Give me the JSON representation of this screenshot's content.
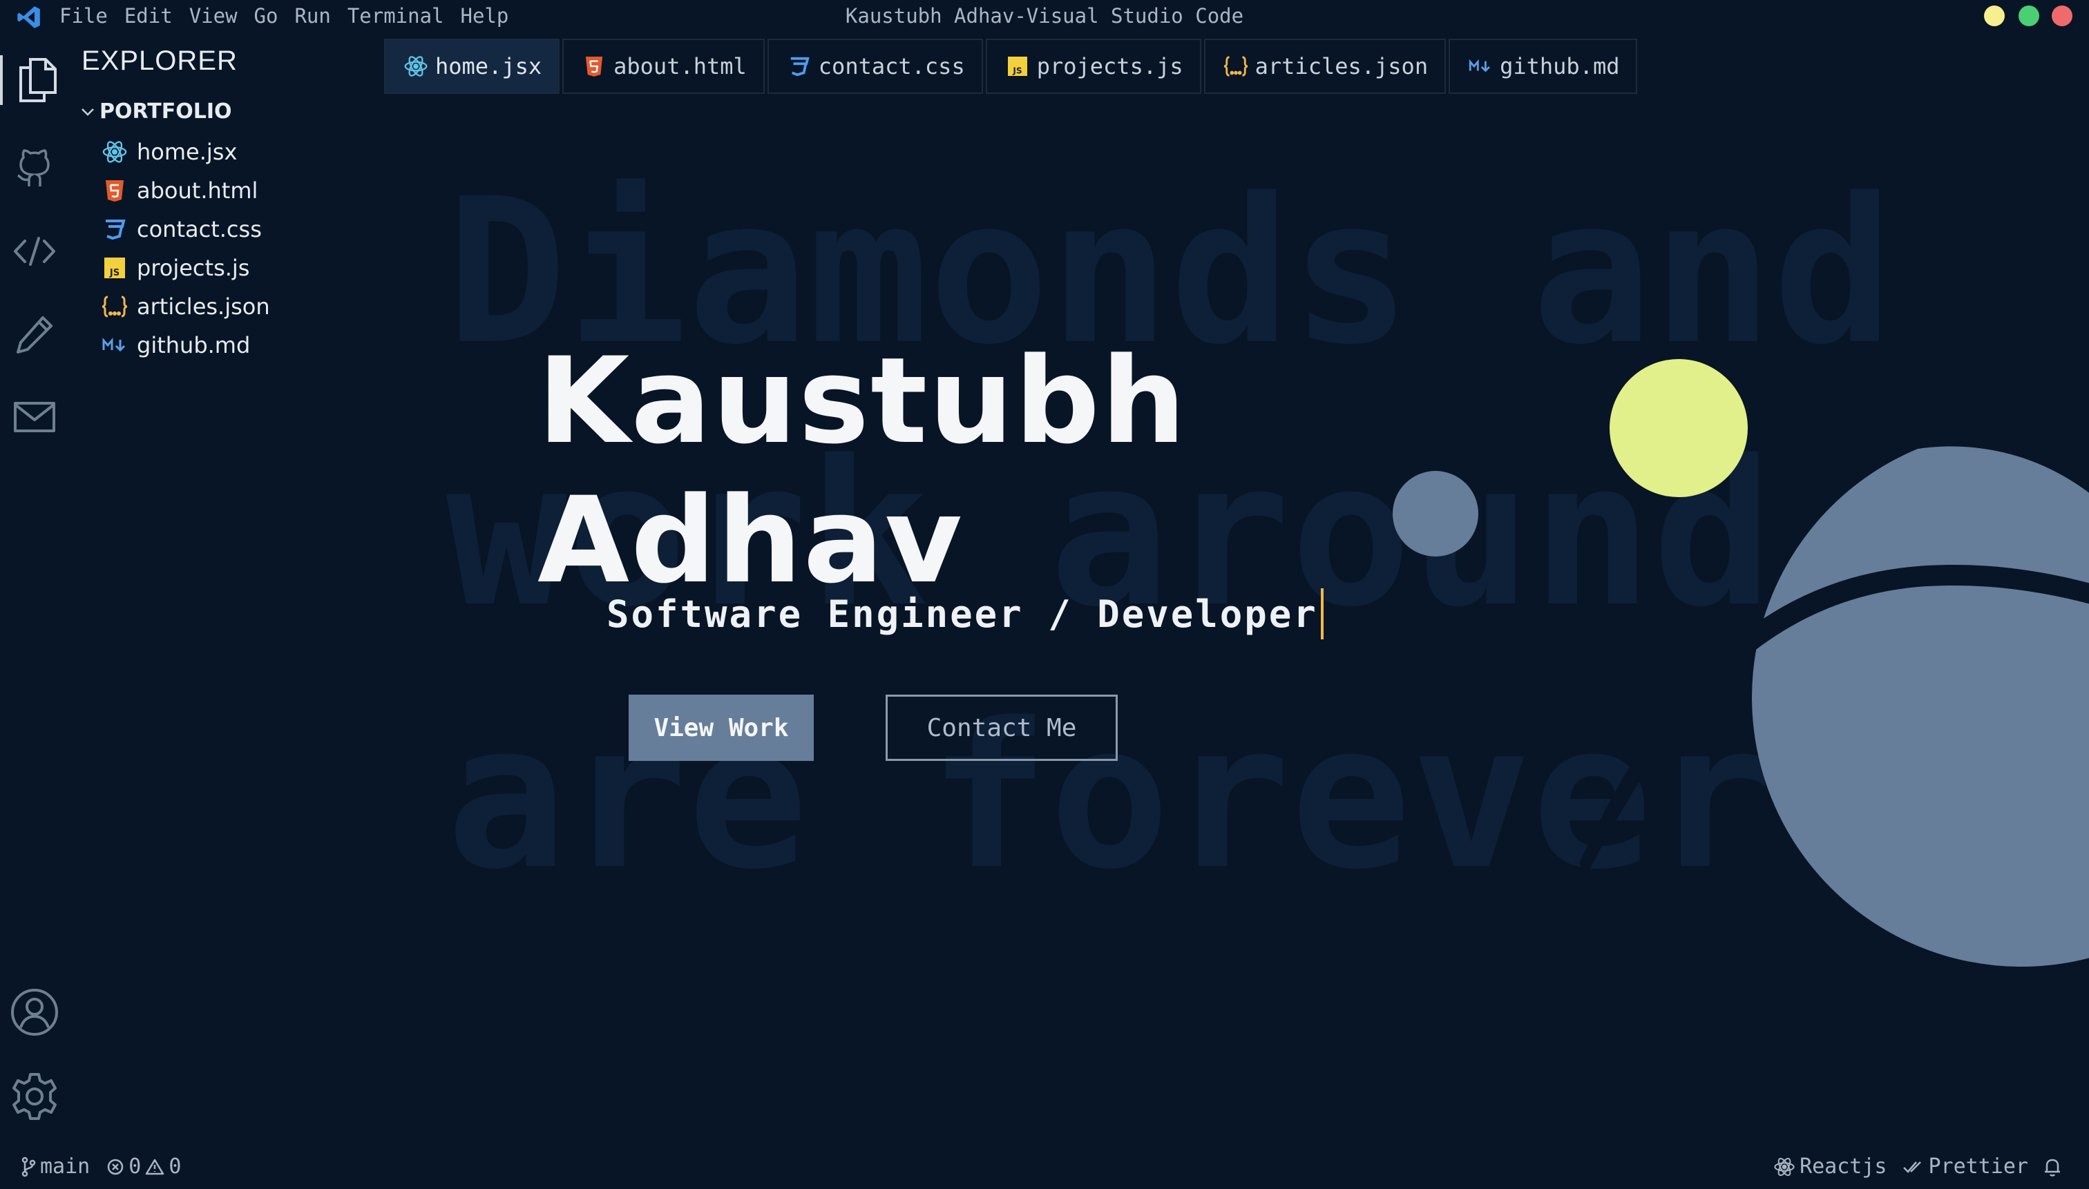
{
  "window": {
    "title": "Kaustubh Adhav-Visual Studio Code",
    "controls": [
      {
        "name": "minimize",
        "color": "#f7ee8f"
      },
      {
        "name": "maximize",
        "color": "#4bcf73"
      },
      {
        "name": "close",
        "color": "#ef6b6b"
      }
    ]
  },
  "menu": [
    "File",
    "Edit",
    "View",
    "Go",
    "Run",
    "Terminal",
    "Help"
  ],
  "activity_bar": {
    "top": [
      "files-icon",
      "github-icon",
      "code-icon",
      "pencil-icon",
      "mail-icon"
    ],
    "bottom": [
      "account-icon",
      "settings-gear-icon"
    ]
  },
  "sidebar": {
    "title": "EXPLORER",
    "folder": "PORTFOLIO",
    "files": [
      {
        "name": "home.jsx",
        "icon": "react-icon"
      },
      {
        "name": "about.html",
        "icon": "html5-icon"
      },
      {
        "name": "contact.css",
        "icon": "css3-icon"
      },
      {
        "name": "projects.js",
        "icon": "javascript-icon"
      },
      {
        "name": "articles.json",
        "icon": "json-icon"
      },
      {
        "name": "github.md",
        "icon": "markdown-icon"
      }
    ]
  },
  "tabs": [
    {
      "label": "home.jsx",
      "icon": "react-icon",
      "active": true
    },
    {
      "label": "about.html",
      "icon": "html5-icon"
    },
    {
      "label": "contact.css",
      "icon": "css3-icon"
    },
    {
      "label": "projects.js",
      "icon": "javascript-icon"
    },
    {
      "label": "articles.json",
      "icon": "json-icon"
    },
    {
      "label": "github.md",
      "icon": "markdown-icon"
    }
  ],
  "hero": {
    "background_lines": [
      "Diamonds and",
      "work around",
      "are forever"
    ],
    "name_line1": "Kaustubh",
    "name_line2": "Adhav",
    "role": "Software Engineer / Developer",
    "primary_button": "View Work",
    "secondary_button": "Contact Me"
  },
  "statusbar": {
    "branch": "main",
    "errors": "0",
    "warnings": "0",
    "right_items": [
      "Reactjs",
      "Prettier"
    ]
  },
  "colors": {
    "background": "#081526",
    "accent_yellow": "#e1f08a",
    "slate": "#667e99",
    "cursor": "#f2b84b"
  }
}
